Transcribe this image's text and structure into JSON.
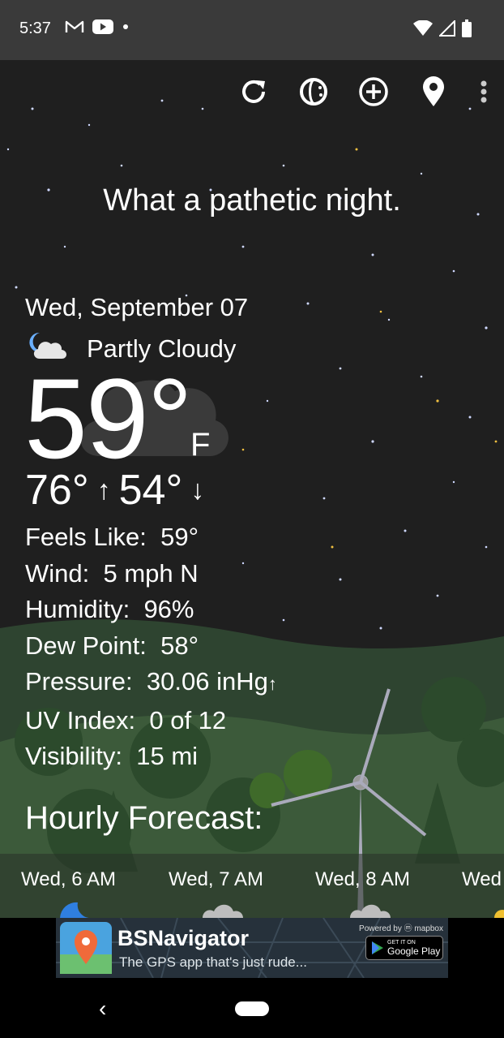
{
  "status_bar": {
    "time": "5:37",
    "left_icons": [
      "gmail-icon",
      "youtube-icon",
      "dot-icon"
    ],
    "right_icons": [
      "wifi-icon",
      "signal-icon",
      "battery-icon"
    ]
  },
  "toolbar": {
    "buttons": [
      "refresh-icon",
      "radar-icon",
      "add-location-icon",
      "location-pin-icon",
      "more-options-icon"
    ]
  },
  "tagline": "What a pathetic night.",
  "current": {
    "date": "Wed, September 07",
    "condition": "Partly Cloudy",
    "condition_icon": "partly-cloudy-night-icon",
    "temperature": "59°",
    "unit": "F",
    "high": "76°",
    "low": "54°"
  },
  "details": [
    {
      "label": "Feels Like:",
      "value": "59°"
    },
    {
      "label": "Wind:",
      "value": "5 mph N"
    },
    {
      "label": "Humidity:",
      "value": "96%"
    },
    {
      "label": "Dew Point:",
      "value": "58°"
    },
    {
      "label": "Pressure:",
      "value": "30.06 inHg",
      "trend": "↑"
    },
    {
      "label": "UV Index:",
      "value": "0 of 12"
    },
    {
      "label": "Visibility:",
      "value": "15 mi"
    }
  ],
  "hourly": {
    "title": "Hourly Forecast:",
    "items": [
      "Wed, 6 AM",
      "Wed, 7 AM",
      "Wed, 8 AM",
      "Wed"
    ]
  },
  "ad": {
    "title": "BSNavigator",
    "subtitle": "The GPS app that's just rude...",
    "powered_by": "Powered by ⓜ mapbox",
    "store_top": "GET IT ON",
    "store_name": "Google Play"
  },
  "colors": {
    "status_bar": "#3a3a3a",
    "sky": "#1f1f1f",
    "hills": "#3c5a3a",
    "ad_bg": "#26313b"
  }
}
